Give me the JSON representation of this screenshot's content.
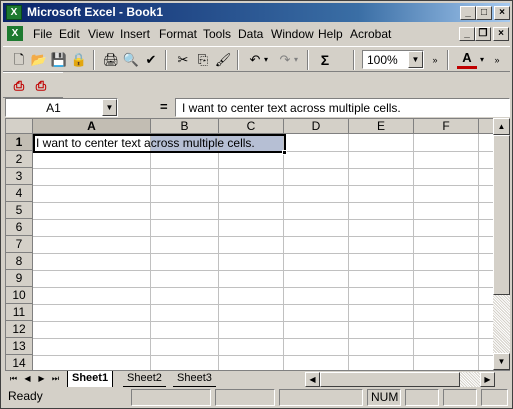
{
  "window": {
    "title": "Microsoft Excel - Book1",
    "app_icon": "X"
  },
  "menu": {
    "doc_icon": "X",
    "items": [
      "File",
      "Edit",
      "View",
      "Insert",
      "Format",
      "Tools",
      "Data",
      "Window",
      "Help",
      "Acrobat"
    ]
  },
  "toolbar": {
    "zoom": "100%",
    "sum_symbol": "Σ",
    "font_color_letter": "A"
  },
  "formula_bar": {
    "cell_ref": "A1",
    "equals": "=",
    "content": "I want to center text across multiple cells."
  },
  "grid": {
    "columns": [
      "A",
      "B",
      "C",
      "D",
      "E",
      "F"
    ],
    "rows": [
      "1",
      "2",
      "3",
      "4",
      "5",
      "6",
      "7",
      "8",
      "9",
      "10",
      "11",
      "12",
      "13",
      "14"
    ],
    "a1_text": "I want to center text across multiple cells."
  },
  "sheets": {
    "tabs": [
      "Sheet1",
      "Sheet2",
      "Sheet3"
    ],
    "active": "Sheet1"
  },
  "status": {
    "mode": "Ready",
    "num": "NUM"
  },
  "colors": {
    "title_gradient_start": "#0a246a",
    "title_gradient_end": "#a6caf0",
    "selection": "#b6bfd4",
    "chrome": "#d4d0c8",
    "excel_green": "#1d7a2f",
    "acrobat_red": "#c00000"
  }
}
